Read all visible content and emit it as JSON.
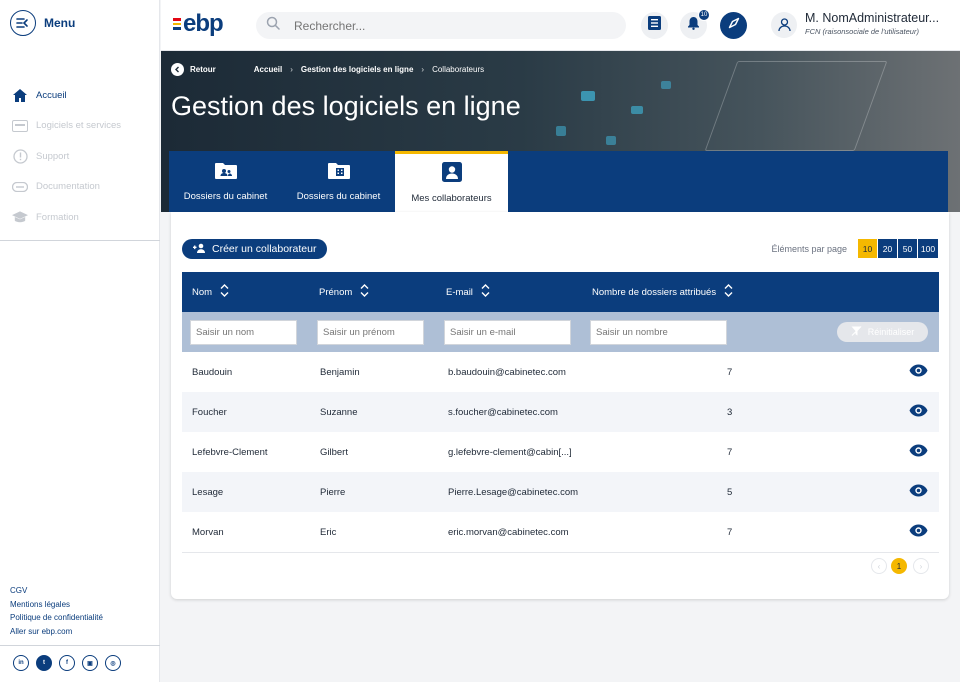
{
  "sidebar": {
    "menu_label": "Menu",
    "nav": [
      {
        "label": "Accueil",
        "icon": "home-icon",
        "active": true
      },
      {
        "label": "Logiciels et services",
        "icon": "services-icon",
        "active": false
      },
      {
        "label": "Support",
        "icon": "support-icon",
        "active": false
      },
      {
        "label": "Documentation",
        "icon": "documentation-icon",
        "active": false
      },
      {
        "label": "Formation",
        "icon": "graduation-cap-icon",
        "active": false
      }
    ],
    "links": [
      "CGV",
      "Mentions légales",
      "Politique de confidentialité",
      "Aller sur ebp.com"
    ],
    "socials": [
      "in",
      "t",
      "f",
      "▣",
      "◎"
    ]
  },
  "topbar": {
    "logo": "ebp",
    "search_placeholder": "Rechercher...",
    "notif_count": "10",
    "user_name": "M. NomAdministrateur...",
    "user_org": "FCN (raisonsociale de l'utilisateur)"
  },
  "banner": {
    "back": "Retour",
    "breadcrumb": [
      "Accueil",
      "Gestion des logiciels en ligne",
      "Collaborateurs"
    ],
    "title": "Gestion des logiciels en ligne",
    "tabs": [
      {
        "label": "Dossiers du cabinet",
        "icon": "folder-users-icon"
      },
      {
        "label": "Dossiers du cabinet",
        "icon": "folder-building-icon"
      },
      {
        "label": "Mes collaborateurs",
        "icon": "user-badge-icon",
        "active": true
      }
    ]
  },
  "content": {
    "create_button": "Créer un collaborateur",
    "per_page_label": "Éléments par page",
    "per_page_options": [
      "10",
      "20",
      "50",
      "100"
    ],
    "per_page_selected": "10",
    "columns": [
      "Nom",
      "Prénom",
      "E-mail",
      "Nombre de dossiers attribués"
    ],
    "filters": [
      "Saisir un nom",
      "Saisir un prénom",
      "Saisir un e-mail",
      "Saisir un nombre"
    ],
    "reset_label": "Réinitialiser",
    "rows": [
      {
        "nom": "Baudouin",
        "prenom": "Benjamin",
        "email": "b.baudouin@cabinetec.com",
        "nombre": "7"
      },
      {
        "nom": "Foucher",
        "prenom": "Suzanne",
        "email": "s.foucher@cabinetec.com",
        "nombre": "3"
      },
      {
        "nom": "Lefebvre-Clement",
        "prenom": "Gilbert",
        "email": "g.lefebvre-clement@cabin[...]",
        "nombre": "7"
      },
      {
        "nom": "Lesage",
        "prenom": "Pierre",
        "email": "Pierre.Lesage@cabinetec.com",
        "nombre": "5"
      },
      {
        "nom": "Morvan",
        "prenom": "Eric",
        "email": "eric.morvan@cabinetec.com",
        "nombre": "7"
      }
    ],
    "current_page": "1"
  },
  "colors": {
    "primary": "#0b3d7d",
    "accent": "#f5b800"
  }
}
